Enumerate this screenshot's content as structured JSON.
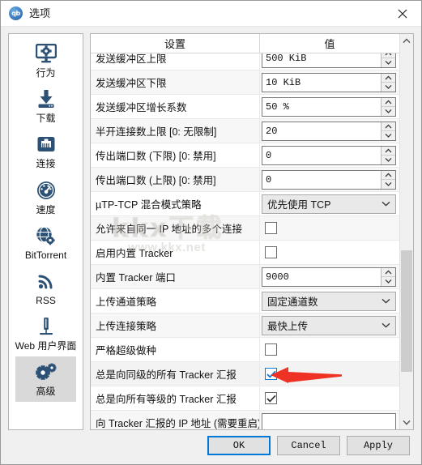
{
  "window": {
    "title": "选项",
    "logo_text": "qb",
    "logo_icon": "qbittorrent-logo",
    "close_icon": "close-icon"
  },
  "sidebar": {
    "items": [
      {
        "label": "行为",
        "icon": "monitor-gear-icon",
        "selected": false
      },
      {
        "label": "下载",
        "icon": "download-icon",
        "selected": false
      },
      {
        "label": "连接",
        "icon": "network-port-icon",
        "selected": false
      },
      {
        "label": "速度",
        "icon": "speedometer-icon",
        "selected": false
      },
      {
        "label": "BitTorrent",
        "icon": "globe-gear-icon",
        "selected": false
      },
      {
        "label": "RSS",
        "icon": "rss-icon",
        "selected": false
      },
      {
        "label": "Web 用户界面",
        "icon": "server-icon",
        "selected": false
      },
      {
        "label": "高级",
        "icon": "gears-icon",
        "selected": true
      }
    ]
  },
  "table": {
    "headers": {
      "setting": "设置",
      "value": "值"
    },
    "rows": [
      {
        "setting": "发送缓冲区上限",
        "type": "spin",
        "value": "500 KiB",
        "clipped": true
      },
      {
        "setting": "发送缓冲区下限",
        "type": "spin",
        "value": "10 KiB"
      },
      {
        "setting": "发送缓冲区增长系数",
        "type": "spin",
        "value": "50 %"
      },
      {
        "setting": "半开连接数上限 [0: 无限制]",
        "type": "spin",
        "value": "20"
      },
      {
        "setting": "传出端口数 (下限) [0: 禁用]",
        "type": "spin",
        "value": "0"
      },
      {
        "setting": "传出端口数 (上限) [0: 禁用]",
        "type": "spin",
        "value": "0"
      },
      {
        "setting": "µTP-TCP 混合模式策略",
        "type": "combo",
        "value": "优先使用 TCP"
      },
      {
        "setting": "允许来自同一 IP 地址的多个连接",
        "type": "checkbox",
        "checked": false
      },
      {
        "setting": "启用内置 Tracker",
        "type": "checkbox",
        "checked": false
      },
      {
        "setting": "内置 Tracker 端口",
        "type": "spin",
        "value": "9000"
      },
      {
        "setting": "上传通道策略",
        "type": "combo",
        "value": "固定通道数"
      },
      {
        "setting": "上传连接策略",
        "type": "combo",
        "value": "最快上传"
      },
      {
        "setting": "严格超级做种",
        "type": "checkbox",
        "checked": false
      },
      {
        "setting": "总是向同级的所有 Tracker 汇报",
        "type": "checkbox",
        "checked": true,
        "highlighted": true,
        "accent": "#0b7ad6"
      },
      {
        "setting": "总是向所有等级的 Tracker 汇报",
        "type": "checkbox",
        "checked": true
      },
      {
        "setting": "向 Tracker 汇报的 IP 地址 (需要重启)",
        "type": "text",
        "value": ""
      }
    ]
  },
  "scrollbar": {
    "up_icon": "chevron-up-icon",
    "down_icon": "chevron-down-icon",
    "thumb_position_percent": 55
  },
  "footer": {
    "ok_label": "OK",
    "cancel_label": "Cancel",
    "apply_label": "Apply"
  },
  "annotation": {
    "arrow_icon": "red-arrow-left",
    "arrow_color": "#ee3324",
    "points_at": "总是向同级的所有 Tracker 汇报"
  },
  "watermark": {
    "cjk_text": "kkx下载",
    "url_text": "www.kkx.net"
  }
}
